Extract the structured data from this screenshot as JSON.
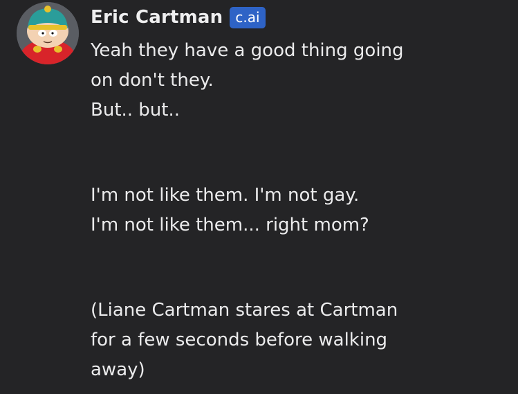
{
  "message": {
    "sender": "Eric Cartman",
    "badge": "c.ai",
    "paragraphs": [
      [
        "Yeah they have a good thing going",
        "on don't they.",
        "But.. but.."
      ],
      [
        "I'm not like them. I'm not gay.",
        "I'm not like them... right mom?"
      ],
      [
        "(Liane Cartman stares at Cartman",
        "for a few seconds before walking",
        "away)"
      ]
    ]
  },
  "colors": {
    "background": "#242426",
    "text": "#ebebec",
    "badge": "#2e63c6"
  }
}
